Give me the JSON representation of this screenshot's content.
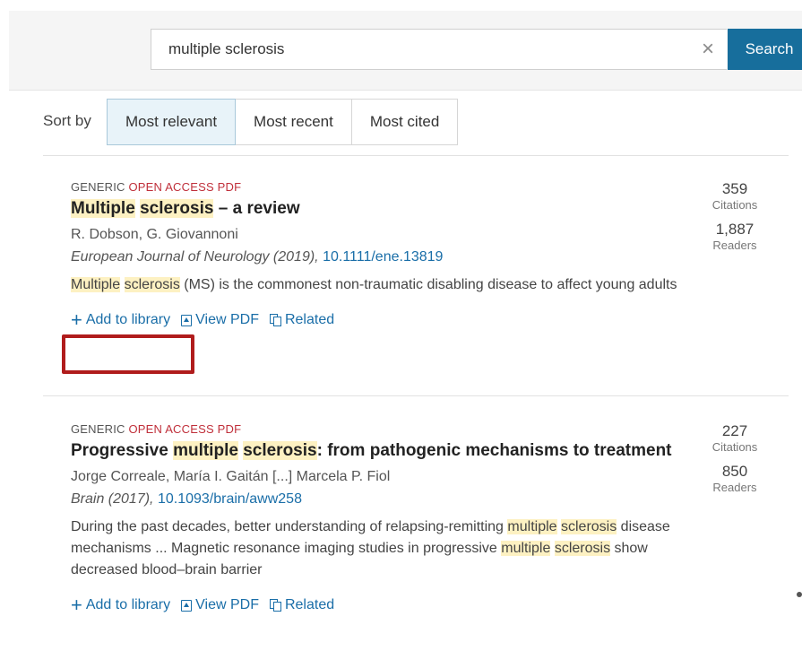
{
  "search": {
    "value": "multiple sclerosis",
    "clear_icon": "×",
    "button_label": "Search",
    "button_color": "#176e9c"
  },
  "sort": {
    "label": "Sort by",
    "options": [
      "Most relevant",
      "Most recent",
      "Most cited"
    ],
    "active": "Most relevant"
  },
  "results": [
    {
      "badge_type": "GENERIC",
      "badge_oa": "OPEN ACCESS",
      "badge_pdf": "PDF",
      "title_parts": [
        {
          "text": "Multiple",
          "hl": true
        },
        {
          "text": " ",
          "hl": false
        },
        {
          "text": "sclerosis",
          "hl": true
        },
        {
          "text": " – a review",
          "hl": false
        }
      ],
      "authors": "R. Dobson, G. Giovannoni",
      "journal": "European Journal of Neurology (2019),",
      "doi": "10.1111/ene.13819",
      "abstract_parts": [
        {
          "text": "Multiple",
          "hl": true
        },
        {
          "text": " ",
          "hl": false
        },
        {
          "text": "sclerosis",
          "hl": true
        },
        {
          "text": " (MS) is the commonest non-traumatic disabling disease to affect young adults",
          "hl": false
        }
      ],
      "citations": "359",
      "citations_label": "Citations",
      "readers": "1,887",
      "readers_label": "Readers"
    },
    {
      "badge_type": "GENERIC",
      "badge_oa": "OPEN ACCESS",
      "badge_pdf": "PDF",
      "title_parts": [
        {
          "text": "Progressive ",
          "hl": false
        },
        {
          "text": "multiple",
          "hl": true
        },
        {
          "text": " ",
          "hl": false
        },
        {
          "text": "sclerosis",
          "hl": true
        },
        {
          "text": ": from pathogenic mechanisms to treatment",
          "hl": false
        }
      ],
      "authors": "Jorge Correale, María I. Gaitán [...] Marcela P. Fiol",
      "journal": "Brain (2017),",
      "doi": "10.1093/brain/aww258",
      "abstract_parts": [
        {
          "text": "During the past decades, better understanding of relapsing-remitting ",
          "hl": false
        },
        {
          "text": "multiple",
          "hl": true
        },
        {
          "text": " ",
          "hl": false
        },
        {
          "text": "sclerosis",
          "hl": true
        },
        {
          "text": " disease mechanisms ... Magnetic resonance imaging studies in progressive ",
          "hl": false
        },
        {
          "text": "multiple",
          "hl": true
        },
        {
          "text": " ",
          "hl": false
        },
        {
          "text": "sclerosis",
          "hl": true
        },
        {
          "text": " show decreased blood–brain barrier",
          "hl": false
        }
      ],
      "citations": "227",
      "citations_label": "Citations",
      "readers": "850",
      "readers_label": "Readers"
    }
  ],
  "actions": {
    "add": "Add to library",
    "add_icon": "+",
    "view_pdf": "View PDF",
    "related": "Related"
  },
  "colors": {
    "highlight": "#fdf1c2",
    "link": "#1a6ea8",
    "open_access": "#c0303b",
    "annotation_box": "#b01c1c"
  }
}
